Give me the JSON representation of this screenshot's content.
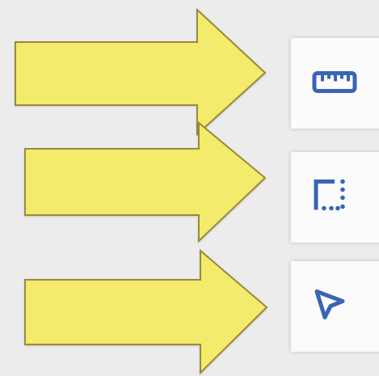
{
  "colors": {
    "background": "#ececec",
    "arrow_fill": "#f3eb6c",
    "arrow_stroke": "#9a8a3a",
    "button_bg": "#fbfbfb",
    "icon": "#3a64b4"
  },
  "annotations": {
    "arrows": [
      {
        "name": "arrow-1",
        "points_to": "measure-tool-button"
      },
      {
        "name": "arrow-2",
        "points_to": "area-tool-button"
      },
      {
        "name": "arrow-3",
        "points_to": "select-tool-button"
      }
    ]
  },
  "toolbar": {
    "tools": [
      {
        "name": "measure-tool",
        "icon": "ruler-icon"
      },
      {
        "name": "area-tool",
        "icon": "dotted-corner-icon"
      },
      {
        "name": "select-tool",
        "icon": "cursor-arrow-icon"
      }
    ]
  }
}
